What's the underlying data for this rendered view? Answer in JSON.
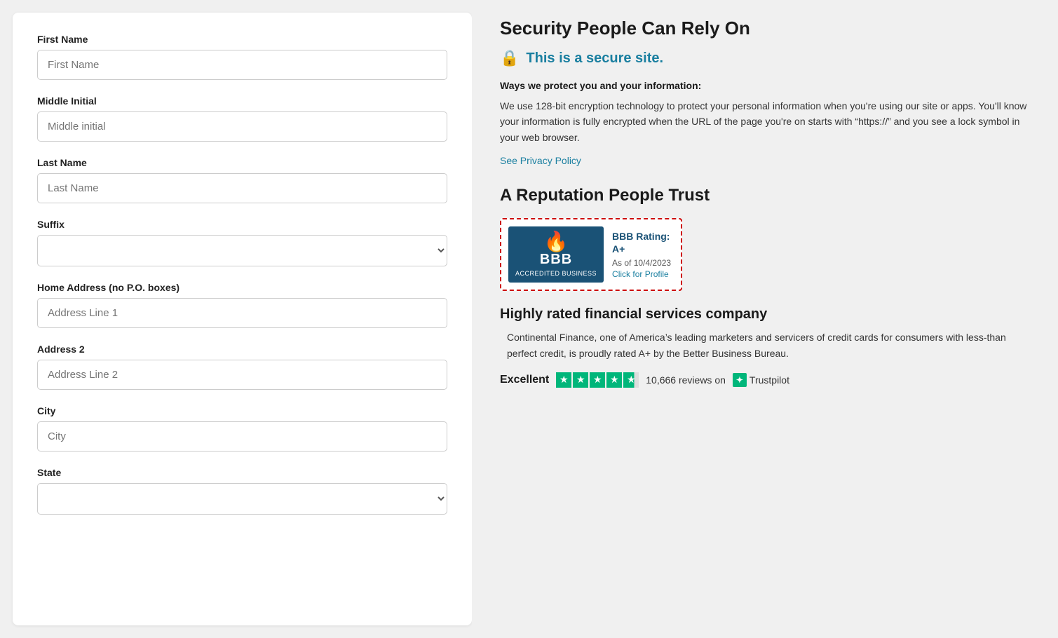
{
  "form": {
    "first_name_label": "First Name",
    "first_name_placeholder": "First Name",
    "middle_initial_label": "Middle Initial",
    "middle_initial_placeholder": "Middle initial",
    "last_name_label": "Last Name",
    "last_name_placeholder": "Last Name",
    "suffix_label": "Suffix",
    "suffix_placeholder": "",
    "home_address_label": "Home Address (no P.O. boxes)",
    "address1_placeholder": "Address Line 1",
    "address2_label": "Address 2",
    "address2_placeholder": "Address Line 2",
    "city_label": "City",
    "city_placeholder": "City",
    "state_label": "State",
    "state_placeholder": ""
  },
  "right": {
    "security_title": "Security People Can Rely On",
    "secure_site_text": "This is a secure site.",
    "ways_protect_label": "Ways we protect you and your information:",
    "encryption_desc": "We use 128-bit encryption technology to protect your personal information when you're using our site or apps. You'll know your information is fully encrypted when the URL of the page you're on starts with “https://” and you see a lock symbol in your web browser.",
    "privacy_link": "See Privacy Policy",
    "reputation_title": "A Reputation People Trust",
    "bbb_rating_label": "BBB Rating: A+",
    "bbb_date": "As of 10/4/2023",
    "bbb_click": "Click for Profile",
    "bbb_text": "BBB",
    "bbb_accredited": "ACCREDITED BUSINESS",
    "highly_rated_title": "Highly rated financial services company",
    "highly_rated_desc": "Continental Finance, one of America’s leading marketers and servicers of credit cards for consumers with less-than perfect credit, is proudly rated A+ by the Better Business Bureau.",
    "trustpilot_excellent": "Excellent",
    "trustpilot_reviews": "10,666 reviews on",
    "trustpilot_name": "Trustpilot"
  }
}
